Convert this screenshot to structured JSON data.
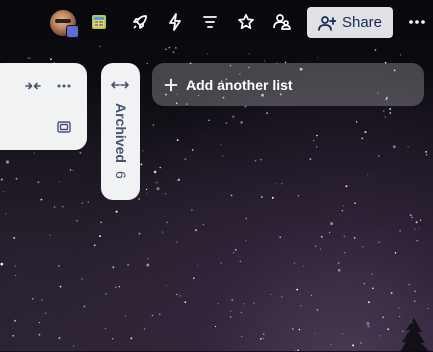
{
  "topbar": {
    "share_label": "Share",
    "icons": [
      "avatar",
      "power-up-icon",
      "automation-rocket-icon",
      "lightning-icon",
      "filter-icon",
      "star-icon",
      "visibility-icon",
      "more-icon"
    ]
  },
  "list": {
    "icons": [
      "collapse-icon",
      "more-icon",
      "card-template-icon"
    ]
  },
  "archived": {
    "label": "Archived",
    "count": "6"
  },
  "add_list": {
    "label": "Add another list"
  },
  "colors": {
    "share_bg": "#dfe1e6",
    "list_bg": "#f1f2f4",
    "text_dark": "#172b4d",
    "text_muted": "#44546f"
  }
}
